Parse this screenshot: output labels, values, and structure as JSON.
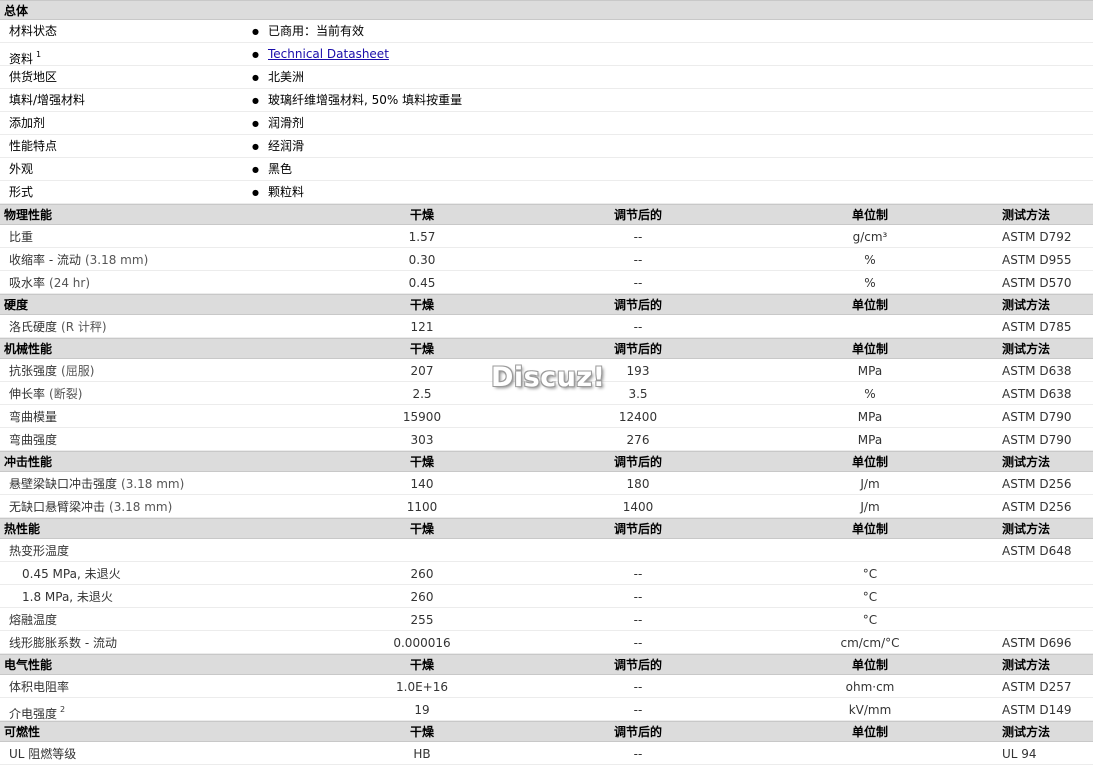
{
  "general": {
    "title": "总体",
    "rows": [
      {
        "label": "材料状态",
        "value": "已商用：当前有效"
      },
      {
        "label": "资料",
        "sup": "1",
        "value": "Technical Datasheet",
        "link": true
      },
      {
        "label": "供货地区",
        "value": "北美洲"
      },
      {
        "label": "填料/增强材料",
        "value": "玻璃纤维增强材料, 50% 填料按重量"
      },
      {
        "label": "添加剂",
        "value": "润滑剂"
      },
      {
        "label": "性能特点",
        "value": "经润滑"
      },
      {
        "label": "外观",
        "value": "黑色"
      },
      {
        "label": "形式",
        "value": "颗粒料"
      }
    ]
  },
  "columns": {
    "dry": "干燥",
    "conditioned": "调节后的",
    "unit": "单位制",
    "test": "测试方法"
  },
  "sections": [
    {
      "title": "物理性能",
      "rows": [
        {
          "name": "比重",
          "dry": "1.57",
          "cond": "--",
          "unit": "g/cm³",
          "test": "ASTM D792"
        },
        {
          "name": "收缩率 - 流动",
          "note": "(3.18 mm)",
          "dry": "0.30",
          "cond": "--",
          "unit": "%",
          "test": "ASTM D955"
        },
        {
          "name": "吸水率",
          "note": "(24 hr)",
          "dry": "0.45",
          "cond": "--",
          "unit": "%",
          "test": "ASTM D570"
        }
      ]
    },
    {
      "title": "硬度",
      "rows": [
        {
          "name": "洛氏硬度",
          "note": "(R 计秤)",
          "dry": "121",
          "cond": "--",
          "unit": "",
          "test": "ASTM D785"
        }
      ]
    },
    {
      "title": "机械性能",
      "rows": [
        {
          "name": "抗张强度",
          "note": "(屈服)",
          "dry": "207",
          "cond": "193",
          "unit": "MPa",
          "test": "ASTM D638"
        },
        {
          "name": "伸长率",
          "note": "(断裂)",
          "dry": "2.5",
          "cond": "3.5",
          "unit": "%",
          "test": "ASTM D638"
        },
        {
          "name": "弯曲模量",
          "dry": "15900",
          "cond": "12400",
          "unit": "MPa",
          "test": "ASTM D790"
        },
        {
          "name": "弯曲强度",
          "dry": "303",
          "cond": "276",
          "unit": "MPa",
          "test": "ASTM D790"
        }
      ]
    },
    {
      "title": "冲击性能",
      "rows": [
        {
          "name": "悬壁梁缺口冲击强度",
          "note": "(3.18 mm)",
          "dry": "140",
          "cond": "180",
          "unit": "J/m",
          "test": "ASTM D256"
        },
        {
          "name": "无缺口悬臂梁冲击",
          "note": "(3.18 mm)",
          "dry": "1100",
          "cond": "1400",
          "unit": "J/m",
          "test": "ASTM D256"
        }
      ]
    },
    {
      "title": "热性能",
      "rows": [
        {
          "name": "热变形温度",
          "dry": "",
          "cond": "",
          "unit": "",
          "test": "ASTM D648"
        },
        {
          "name": "0.45 MPa, 未退火",
          "sub": true,
          "dry": "260",
          "cond": "--",
          "unit": "°C",
          "test": ""
        },
        {
          "name": "1.8 MPa, 未退火",
          "sub": true,
          "dry": "260",
          "cond": "--",
          "unit": "°C",
          "test": ""
        },
        {
          "name": "熔融温度",
          "dry": "255",
          "cond": "--",
          "unit": "°C",
          "test": ""
        },
        {
          "name": "线形膨胀系数 - 流动",
          "dry": "0.000016",
          "cond": "--",
          "unit": "cm/cm/°C",
          "test": "ASTM D696"
        }
      ]
    },
    {
      "title": "电气性能",
      "rows": [
        {
          "name": "体积电阻率",
          "dry": "1.0E+16",
          "cond": "--",
          "unit": "ohm·cm",
          "test": "ASTM D257"
        },
        {
          "name": "介电强度",
          "sup": "2",
          "dry": "19",
          "cond": "--",
          "unit": "kV/mm",
          "test": "ASTM D149"
        }
      ]
    },
    {
      "title": "可燃性",
      "rows": [
        {
          "name": "UL 阻燃等级",
          "dry": "HB",
          "cond": "--",
          "unit": "",
          "test": "UL 94"
        }
      ]
    }
  ],
  "watermark": "Discuz!"
}
